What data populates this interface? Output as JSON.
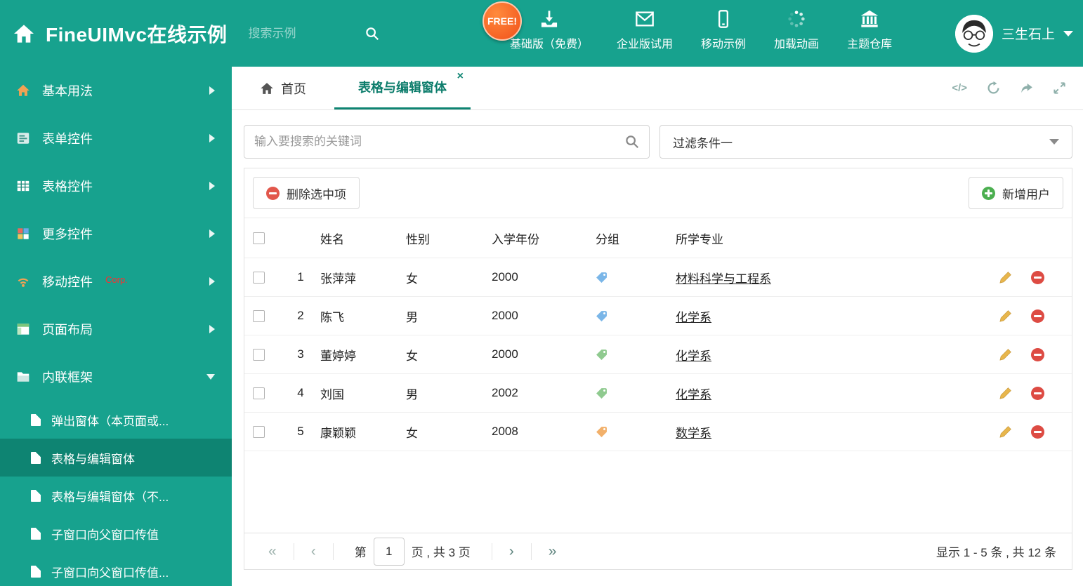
{
  "header": {
    "title": "FineUIMvc在线示例",
    "search_placeholder": "搜索示例",
    "free_badge": "FREE!",
    "nav": [
      {
        "icon": "download-icon",
        "label": "基础版（免费）"
      },
      {
        "icon": "envelope-icon",
        "label": "企业版试用"
      },
      {
        "icon": "mobile-icon",
        "label": "移动示例"
      },
      {
        "icon": "spinner-icon",
        "label": "加载动画"
      },
      {
        "icon": "bank-icon",
        "label": "主题仓库"
      }
    ],
    "user_name": "三生石上"
  },
  "sidebar": {
    "items": [
      {
        "icon": "home-icon",
        "label": "基本用法"
      },
      {
        "icon": "form-icon",
        "label": "表单控件"
      },
      {
        "icon": "table-icon",
        "label": "表格控件"
      },
      {
        "icon": "blocks-icon",
        "label": "更多控件"
      },
      {
        "icon": "signal-icon",
        "label": "移动控件",
        "badge": "Corp."
      },
      {
        "icon": "layout-icon",
        "label": "页面布局"
      },
      {
        "icon": "frame-icon",
        "label": "内联框架"
      }
    ],
    "subitems": [
      {
        "label": "弹出窗体（本页面或..."
      },
      {
        "label": "表格与编辑窗体"
      },
      {
        "label": "表格与编辑窗体（不..."
      },
      {
        "label": "子窗口向父窗口传值"
      },
      {
        "label": "子窗口向父窗口传值..."
      }
    ]
  },
  "tabs": {
    "home": "首页",
    "active": "表格与编辑窗体",
    "close": "×",
    "code_icon_label": "</>"
  },
  "toolbar": {
    "search_placeholder": "输入要搜索的关键词",
    "filter_value": "过滤条件一",
    "delete_label": "删除选中项",
    "add_label": "新增用户"
  },
  "table": {
    "columns": {
      "name": "姓名",
      "gender": "性别",
      "year": "入学年份",
      "group": "分组",
      "major": "所学专业"
    },
    "rows": [
      {
        "num": "1",
        "name": "张萍萍",
        "gender": "女",
        "year": "2000",
        "tag_color": "#7ab6e8",
        "major": "材料科学与工程系"
      },
      {
        "num": "2",
        "name": "陈飞",
        "gender": "男",
        "year": "2000",
        "tag_color": "#7ab6e8",
        "major": "化学系"
      },
      {
        "num": "3",
        "name": "董婷婷",
        "gender": "女",
        "year": "2000",
        "tag_color": "#8fca8f",
        "major": "化学系"
      },
      {
        "num": "4",
        "name": "刘国",
        "gender": "男",
        "year": "2002",
        "tag_color": "#8fca8f",
        "major": "化学系"
      },
      {
        "num": "5",
        "name": "康颖颖",
        "gender": "女",
        "year": "2008",
        "tag_color": "#f2b06a",
        "major": "数学系"
      }
    ]
  },
  "pagination": {
    "first": "«",
    "prev": "‹",
    "label_prefix": "第",
    "page_value": "1",
    "label_suffix": "页 , 共 3 页",
    "next": "›",
    "last": "»",
    "summary": "显示 1 - 5 条 , 共 12 条"
  },
  "colors": {
    "theme": "#17a28e",
    "sidebar_active": "#0e8472",
    "tab_active": "#0d7d6c",
    "free_badge": "#f1511b",
    "delete_red": "#dd4b43",
    "add_green": "#4caf50",
    "edit_gold": "#e8b64c"
  }
}
